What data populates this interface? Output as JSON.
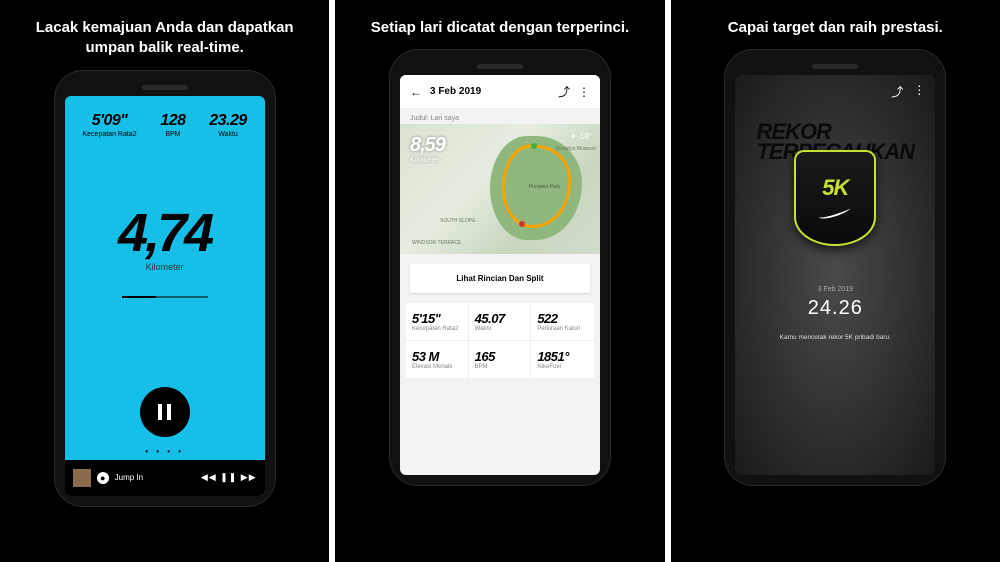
{
  "panels": [
    {
      "caption": "Lacak kemajuan Anda dan dapatkan umpan balik real-time."
    },
    {
      "caption": "Setiap lari dicatat dengan terperinci."
    },
    {
      "caption": "Capai target dan raih prestasi."
    }
  ],
  "screen1": {
    "stats": [
      {
        "value": "5'09\"",
        "label": "Kecepatan Rata2"
      },
      {
        "value": "128",
        "label": "BPM"
      },
      {
        "value": "23.29",
        "label": "Waktu"
      }
    ],
    "main_value": "4,74",
    "main_label": "Kilometer",
    "page_dots": "• • • •",
    "music": {
      "track": "Jump In",
      "controls": "◀◀  ❚❚  ▶▶"
    }
  },
  "screen2": {
    "header_date": "3 Feb 2019",
    "judul": "Judul: Lari saya",
    "distance": {
      "value": "8,59",
      "label": "Kilometer"
    },
    "weather_temp": "18°",
    "map_labels": {
      "a": "Brooklyn Museum",
      "b": "Prospect Park",
      "c": "WINDSOR TERRACE",
      "d": "SOUTH SLOPE"
    },
    "button": "Lihat Rincian Dan Split",
    "grid": [
      {
        "value": "5'15''",
        "label": "Kecepatan Rata2"
      },
      {
        "value": "45.07",
        "label": "Waktu"
      },
      {
        "value": "522",
        "label": "Perkiraan Kalori"
      },
      {
        "value": "53 M",
        "label": "Elevasi Menaik"
      },
      {
        "value": "165",
        "label": "BPM"
      },
      {
        "value": "1851°",
        "label": "NikeFuel"
      }
    ]
  },
  "screen3": {
    "headline1": "REKOR",
    "headline2": "TERPECAHKAN",
    "badge_text": "5K",
    "date": "3 Feb 2019",
    "value": "24.26",
    "message": "Kamu mencetak rekor 5K pribadi baru."
  }
}
